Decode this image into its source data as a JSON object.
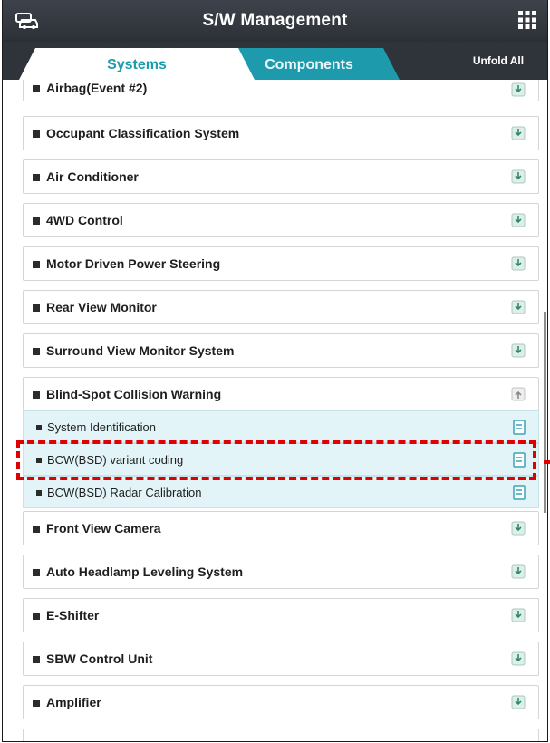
{
  "header": {
    "title": "S/W Management",
    "car_icon": "car-icon",
    "menu_icon": "grid-menu-icon"
  },
  "tabs": [
    {
      "label": "Systems",
      "active": true
    },
    {
      "label": "Components",
      "active": false
    }
  ],
  "unfold_label": "Unfold All",
  "colors": {
    "accent": "#1e9aad",
    "header": "#2f343b",
    "highlight": "#e00000",
    "sub_bg": "#e2f4f7"
  },
  "items": [
    {
      "label": "Airbag(Event #2)"
    },
    {
      "label": "Occupant Classification System"
    },
    {
      "label": "Air Conditioner"
    },
    {
      "label": "4WD Control"
    },
    {
      "label": "Motor Driven Power Steering"
    },
    {
      "label": "Rear View Monitor"
    },
    {
      "label": "Surround View Monitor System"
    },
    {
      "label": "Blind-Spot Collision Warning",
      "expanded": true
    }
  ],
  "subitems": [
    {
      "label": "System Identification"
    },
    {
      "label": "BCW(BSD) variant coding",
      "highlighted": true
    },
    {
      "label": "BCW(BSD) Radar Calibration"
    }
  ],
  "items_after": [
    {
      "label": "Front View Camera"
    },
    {
      "label": "Auto Headlamp Leveling System"
    },
    {
      "label": "E-Shifter"
    },
    {
      "label": "SBW Control Unit"
    },
    {
      "label": "Amplifier"
    }
  ]
}
